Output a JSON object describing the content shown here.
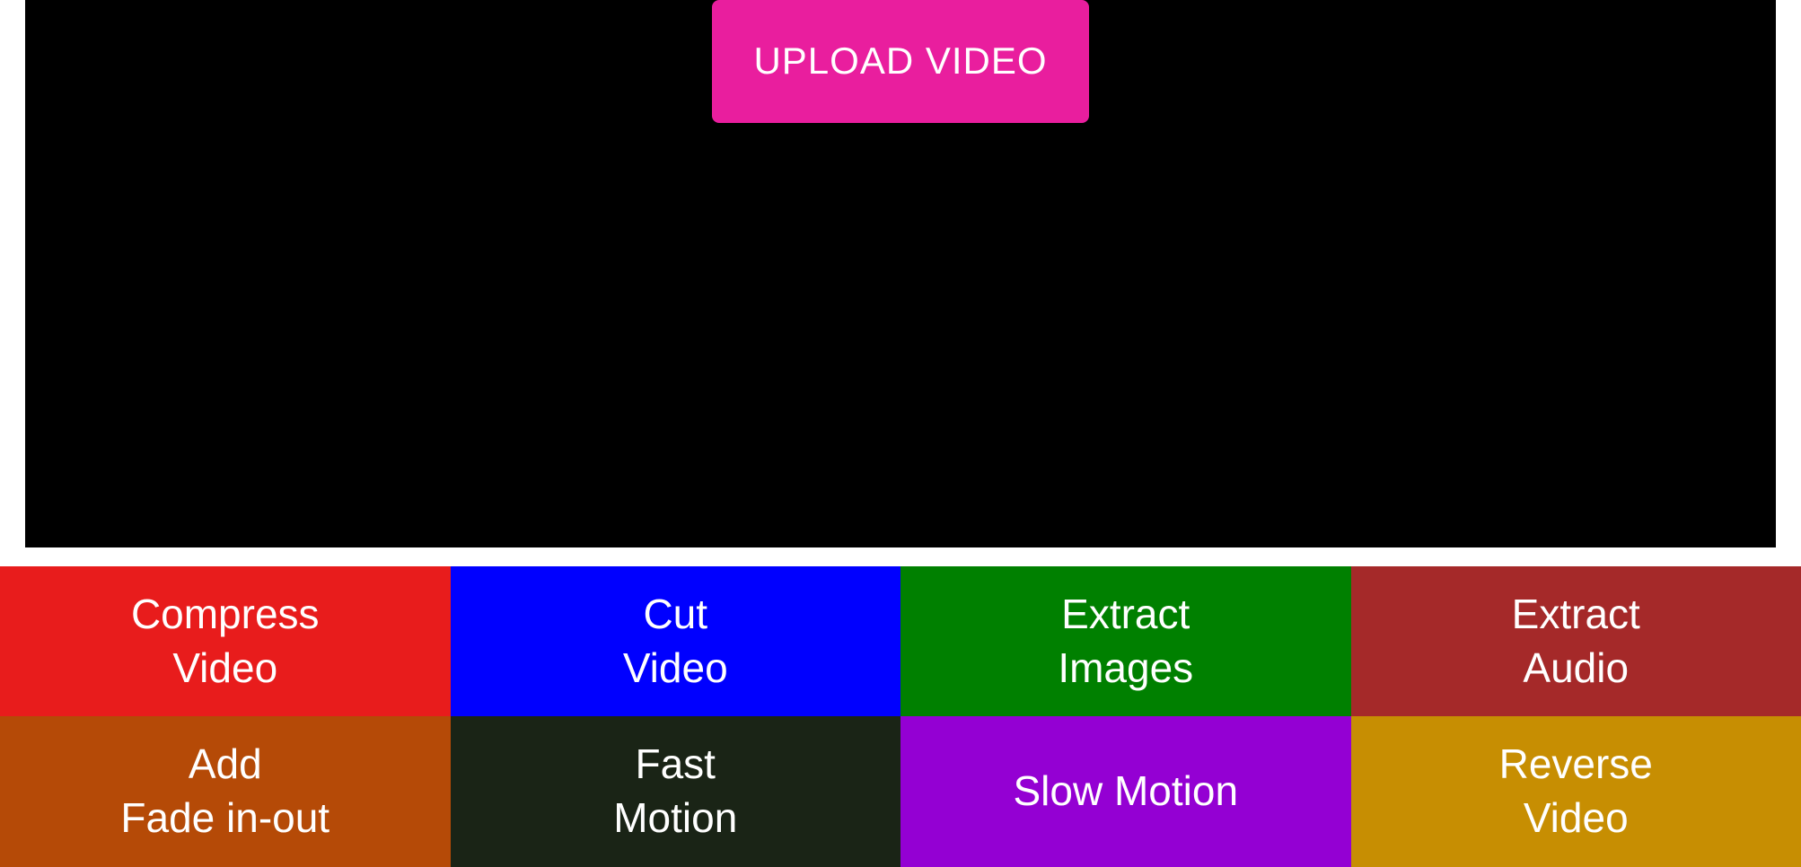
{
  "upload": {
    "label": "UPLOAD\nVIDEO"
  },
  "actions": {
    "compress": {
      "label": "Compress\nVideo",
      "color": "#e81c1c"
    },
    "cut": {
      "label": "Cut\nVideo",
      "color": "#0000ff"
    },
    "extract_images": {
      "label": "Extract\nImages",
      "color": "#008000"
    },
    "extract_audio": {
      "label": "Extract\nAudio",
      "color": "#a52929"
    },
    "add_fade": {
      "label": "Add\nFade in-out",
      "color": "#b54a07"
    },
    "fast_motion": {
      "label": "Fast\nMotion",
      "color": "#1a2416"
    },
    "slow_motion": {
      "label": "Slow Motion",
      "color": "#9400d3"
    },
    "reverse": {
      "label": "Reverse\nVideo",
      "color": "#c78e02"
    }
  }
}
